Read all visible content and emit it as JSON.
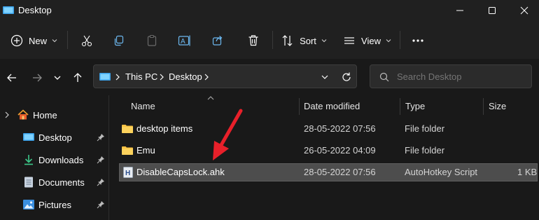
{
  "window": {
    "title": "Desktop",
    "minimize_icon": "minimize-icon",
    "maximize_icon": "maximize-icon",
    "close_icon": "close-icon"
  },
  "toolbar": {
    "new_label": "New",
    "sort_label": "Sort",
    "view_label": "View",
    "icons": [
      "plus-circle-icon",
      "cut-icon",
      "copy-icon",
      "paste-icon",
      "rename-icon",
      "share-icon",
      "delete-icon",
      "sort-icon",
      "view-icon",
      "more-icon"
    ]
  },
  "navigation": {
    "breadcrumb": [
      "This PC",
      "Desktop"
    ],
    "search_placeholder": "Search Desktop"
  },
  "sidebar": {
    "items": [
      {
        "label": "Home",
        "icon": "home-icon",
        "pinned": false
      },
      {
        "label": "Desktop",
        "icon": "desktop-icon",
        "pinned": true
      },
      {
        "label": "Downloads",
        "icon": "download-icon",
        "pinned": true
      },
      {
        "label": "Documents",
        "icon": "document-icon",
        "pinned": true
      },
      {
        "label": "Pictures",
        "icon": "picture-icon",
        "pinned": true
      }
    ]
  },
  "file_list": {
    "columns": [
      "Name",
      "Date modified",
      "Type",
      "Size"
    ],
    "rows": [
      {
        "name": "desktop items",
        "date": "28-05-2022 07:56",
        "type": "File folder",
        "size": "",
        "icon": "folder-icon"
      },
      {
        "name": "Emu",
        "date": "26-05-2022 04:09",
        "type": "File folder",
        "size": "",
        "icon": "folder-icon"
      },
      {
        "name": "DisableCapsLock.ahk",
        "date": "28-05-2022 07:56",
        "type": "AutoHotkey Script",
        "size": "1 KB",
        "icon": "ahk-script-icon",
        "selected": true
      }
    ]
  },
  "colors": {
    "accent": "#4cc2ff",
    "folder": "#f8c244",
    "selected_row": "#4d4d4d",
    "annotation_arrow": "#e8202a"
  }
}
